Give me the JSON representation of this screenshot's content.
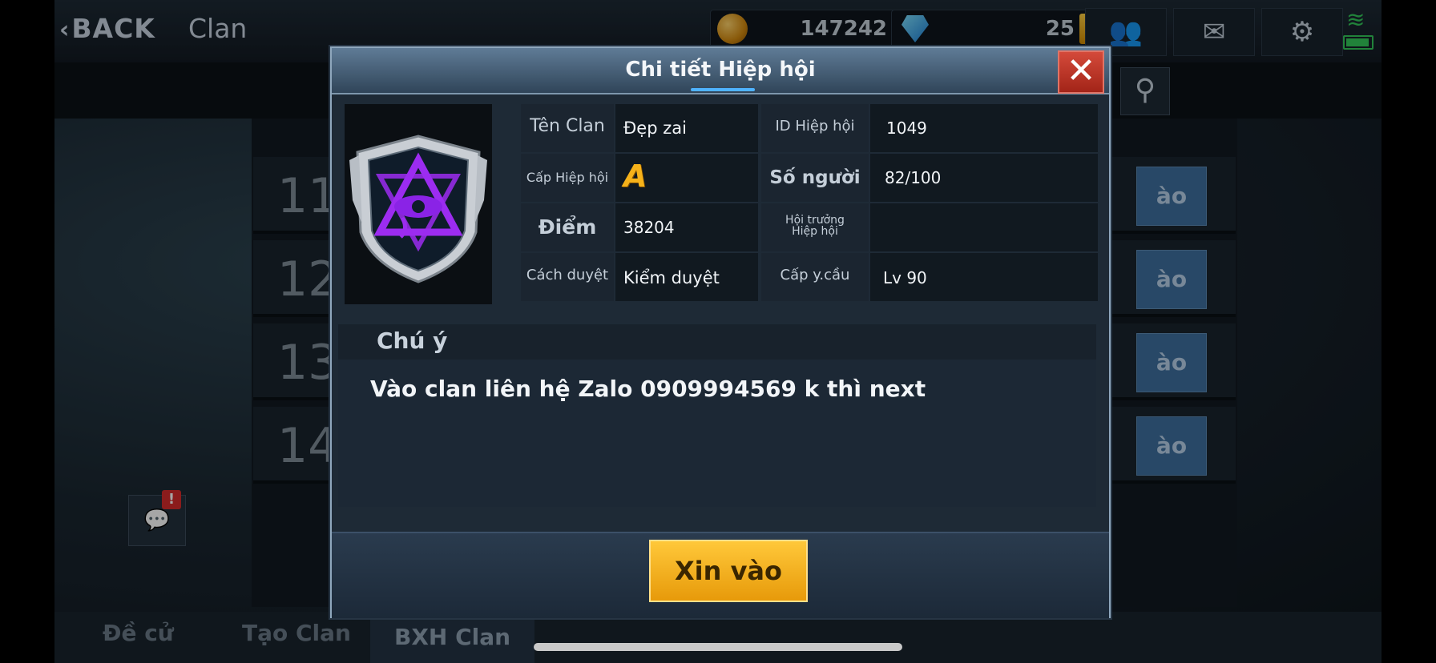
{
  "topbar": {
    "back_label": "BACK",
    "title": "Clan",
    "gold_value": "147242",
    "gem_value": "25",
    "plus": "+"
  },
  "rank_rows": [
    {
      "num": "11",
      "btn": "ào"
    },
    {
      "num": "12",
      "btn": "ào"
    },
    {
      "num": "13",
      "btn": "ào"
    },
    {
      "num": "14",
      "btn": "ào"
    }
  ],
  "bottom_tabs": [
    "Đề cử",
    "Tạo Clan",
    "BXH Clan"
  ],
  "chat_badge": "!",
  "modal": {
    "title": "Chi tiết Hiệp hội",
    "close": "✕",
    "rows": {
      "clan_name_label": "Tên Clan",
      "clan_name": "Đẹp zai",
      "clan_id_label": "ID Hiệp hội",
      "clan_id": "1049",
      "level_label": "Cấp Hiệp hội",
      "level_grade": "A",
      "members_label": "Số người",
      "members": "82/100",
      "points_label": "Điểm",
      "points": "38204",
      "leader_label": "Hội trưởng Hiệp hội",
      "leader": "",
      "approval_label": "Cách duyệt",
      "approval": "Kiểm duyệt",
      "req_level_label": "Cấp y.cầu",
      "req_level": "Lv 90"
    },
    "notice_title": "Chú ý",
    "notice_text": "Vào clan liên hệ Zalo 0909994569 k thì next",
    "join_button": "Xin vào"
  },
  "colors": {
    "accent_gold": "#f2a80f",
    "close_red": "#c0392b",
    "emblem_purple": "#8b2be2"
  }
}
